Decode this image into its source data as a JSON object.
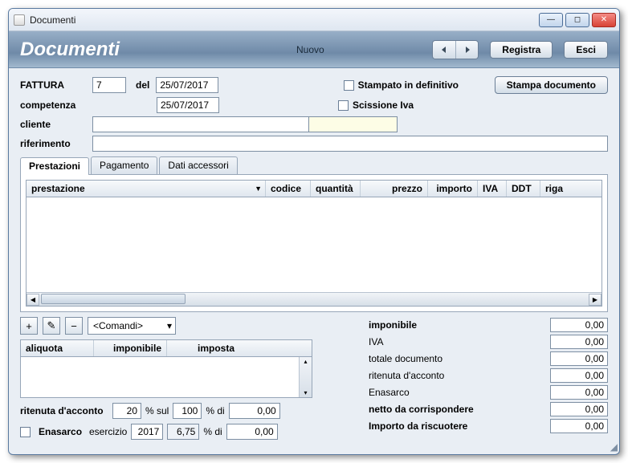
{
  "window": {
    "title": "Documenti"
  },
  "banner": {
    "title": "Documenti",
    "status": "Nuovo",
    "registra": "Registra",
    "esci": "Esci"
  },
  "form": {
    "doc_type": "FATTURA",
    "doc_num": "7",
    "del_label": "del",
    "doc_date": "25/07/2017",
    "competenza_label": "competenza",
    "competenza_value": "25/07/2017",
    "cliente_label": "cliente",
    "cliente_value": "",
    "riferimento_label": "riferimento",
    "riferimento_value": "",
    "stampato_def": "Stampato in definitivo",
    "scissione": "Scissione Iva",
    "stampa_doc": "Stampa documento"
  },
  "tabs": [
    "Prestazioni",
    "Pagamento",
    "Dati accessori"
  ],
  "grid_headers": {
    "prestazione": "prestazione",
    "codice": "codice",
    "quantita": "quantità",
    "prezzo": "prezzo",
    "importo": "importo",
    "iva": "IVA",
    "ddt": "DDT",
    "riga": "riga"
  },
  "toolbar": {
    "add": "+",
    "edit": "✎",
    "del": "−",
    "comandi": "<Comandi>"
  },
  "iva_grid": {
    "aliquota": "aliquota",
    "imponibile": "imponibile",
    "imposta": "imposta"
  },
  "ritenuta": {
    "label": "ritenuta d'acconto",
    "pct": "20",
    "pct_sul": "% sul",
    "base": "100",
    "pct_di": "% di",
    "amount": "0,00"
  },
  "enasarco": {
    "label": "Enasarco",
    "esercizio_label": "esercizio",
    "esercizio": "2017",
    "rate": "6,75",
    "pct_di": "% di",
    "amount": "0,00"
  },
  "totals": {
    "imponibile": {
      "label": "imponibile",
      "value": "0,00",
      "bold": true
    },
    "iva": {
      "label": "IVA",
      "value": "0,00"
    },
    "totale_doc": {
      "label": "totale documento",
      "value": "0,00"
    },
    "ritenuta": {
      "label": "ritenuta d'acconto",
      "value": "0,00"
    },
    "enasarco": {
      "label": "Enasarco",
      "value": "0,00"
    },
    "netto": {
      "label": "netto da corrispondere",
      "value": "0,00",
      "bold": true
    },
    "importo_risc": {
      "label": "Importo da riscuotere",
      "value": "0,00",
      "bold": true
    }
  }
}
